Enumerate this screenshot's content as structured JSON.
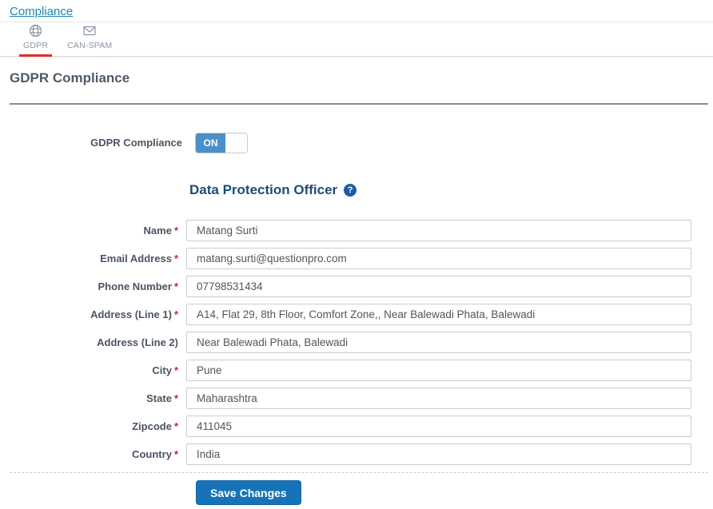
{
  "breadcrumb": {
    "label": "Compliance"
  },
  "tabs": [
    {
      "label": "GDPR",
      "icon": "gdpr-globe-icon",
      "active": true
    },
    {
      "label": "CAN-SPAM",
      "icon": "envelope-icon",
      "active": false
    }
  ],
  "page": {
    "title": "GDPR Compliance"
  },
  "toggle": {
    "label": "GDPR Compliance",
    "state": "ON"
  },
  "section": {
    "title": "Data Protection Officer",
    "help_icon": "help-icon"
  },
  "form": {
    "required_marker": "*",
    "fields": [
      {
        "label": "Name",
        "required": true,
        "value": "Matang Surti"
      },
      {
        "label": "Email Address",
        "required": true,
        "value": "matang.surti@questionpro.com"
      },
      {
        "label": "Phone Number",
        "required": true,
        "value": "07798531434"
      },
      {
        "label": "Address (Line 1)",
        "required": true,
        "value": "A14, Flat 29, 8th Floor, Comfort Zone,, Near Balewadi Phata, Balewadi"
      },
      {
        "label": "Address (Line 2)",
        "required": false,
        "value": "Near Balewadi Phata, Balewadi"
      },
      {
        "label": "City",
        "required": true,
        "value": "Pune"
      },
      {
        "label": "State",
        "required": true,
        "value": "Maharashtra"
      },
      {
        "label": "Zipcode",
        "required": true,
        "value": "411045"
      },
      {
        "label": "Country",
        "required": true,
        "value": "India"
      }
    ],
    "save_label": "Save Changes"
  },
  "colors": {
    "link_teal": "#1B87AB",
    "tab_gray": "#8A95A3",
    "accent_red": "#E02D2D",
    "heading_slate": "#4F5A66",
    "heading_navy": "#1E4C77",
    "help_blue": "#1C5FA6",
    "label_slate": "#4A5462",
    "required_red": "#C0272D",
    "toggle_blue": "#4A90CB",
    "button_blue": "#1673B8"
  }
}
